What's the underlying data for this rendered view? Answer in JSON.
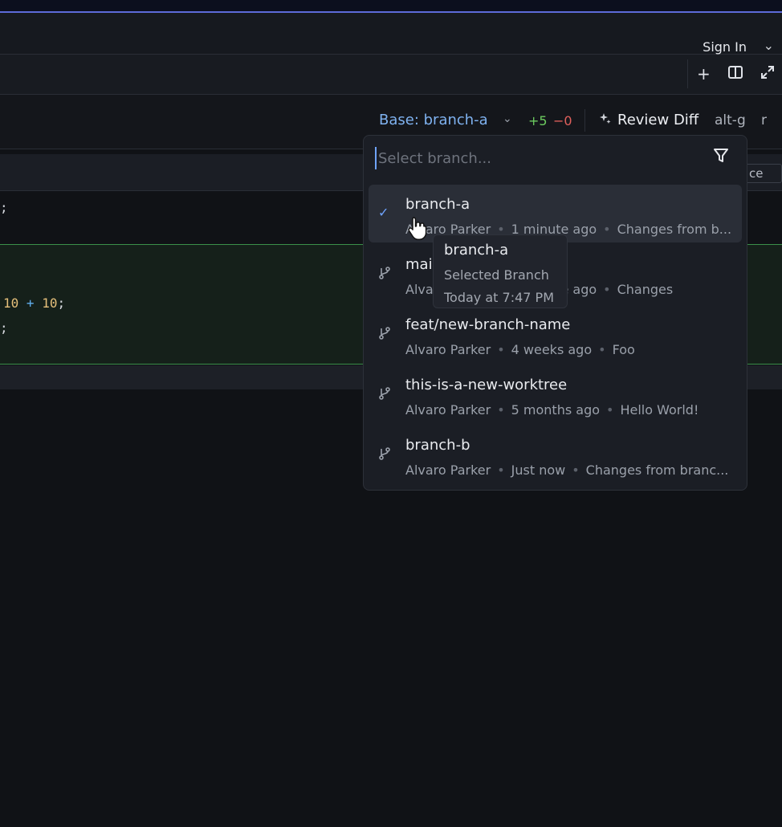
{
  "header": {
    "sign_in": "Sign In"
  },
  "diff_header": {
    "base_label": "Base: branch-a",
    "additions": "+5",
    "deletions": "−0",
    "review_label": "Review Diff",
    "shortcut": "alt-g",
    "shortcut2": "r"
  },
  "file_bar": {
    "trailing_button": "ce"
  },
  "code_lines": [
    {
      "text": ";"
    },
    {
      "num1": "10",
      "op": "+",
      "num2": "10",
      "end": ";"
    },
    {
      "text": ";"
    }
  ],
  "branch_picker": {
    "search_placeholder": "Select branch...",
    "items": [
      {
        "name": "branch-a",
        "author": "Alvaro Parker",
        "time": "1 minute ago",
        "message": "Changes from b...",
        "selected": true
      },
      {
        "name": "main",
        "author": "Alvaro Parker",
        "time": "1 minute ago",
        "message": "Changes",
        "selected": false
      },
      {
        "name": "feat/new-branch-name",
        "author": "Alvaro Parker",
        "time": "4 weeks ago",
        "message": "Foo",
        "selected": false
      },
      {
        "name": "this-is-a-new-worktree",
        "author": "Alvaro Parker",
        "time": "5 months ago",
        "message": "Hello World!",
        "selected": false
      },
      {
        "name": "branch-b",
        "author": "Alvaro Parker",
        "time": "Just now",
        "message": "Changes from branc...",
        "selected": false
      }
    ]
  },
  "tooltip": {
    "title": "branch-a",
    "subtitle": "Selected Branch",
    "time": "Today at 7:47 PM"
  },
  "colors": {
    "accent": "#6fa3ff",
    "additions": "#6ccb5f",
    "deletions": "#e0605c"
  },
  "icons": {
    "selected": "check-icon",
    "branch": "git-branch-icon",
    "filter": "filter-icon"
  }
}
